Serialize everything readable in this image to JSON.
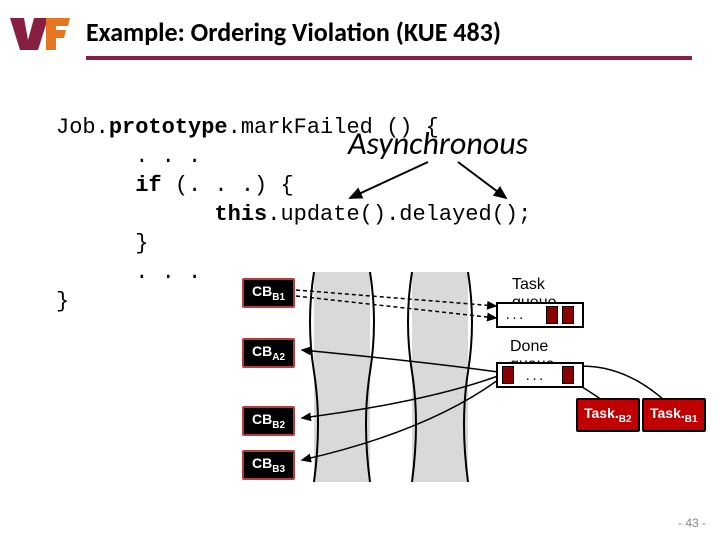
{
  "header": {
    "title": "Example: Ordering Violation (KUE 483)"
  },
  "code": {
    "l1a": "Job.",
    "l1b": "prototype",
    "l1c": ".mark",
    "l1d": "Failed",
    "l1e": " () {",
    "l2": ". . .",
    "l3a": "if",
    "l3b": " (. . .) {",
    "l4a": "this",
    "l4b": ".update().delayed();",
    "l5": "}",
    "l6": ". . .",
    "l7": "}"
  },
  "annotation": "Asynchronous",
  "diagram": {
    "cb_b1": "CB",
    "cb_b1_sub": "B1",
    "cb_a2": "CB",
    "cb_a2_sub": "A2",
    "cb_b2": "CB",
    "cb_b2_sub": "B2",
    "cb_b3": "CB",
    "cb_b3_sub": "B3",
    "task_b2": "Task.",
    "task_b2_sub": "B2",
    "task_b1": "Task.",
    "task_b1_sub": "B1",
    "task_queue_label": "Task queue",
    "done_queue_label": "Done queue",
    "dots": ". . ."
  },
  "footer": {
    "page": "- 43 -"
  }
}
